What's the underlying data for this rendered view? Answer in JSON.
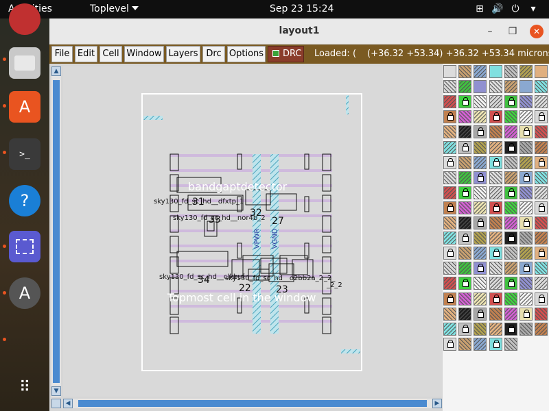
{
  "topbar": {
    "activities": "Activities",
    "app": "Toplevel",
    "clock": "Sep 23  15:24"
  },
  "window": {
    "title": "layout1"
  },
  "menu": [
    "File",
    "Edit",
    "Cell",
    "Window",
    "Layers",
    "Drc",
    "Options"
  ],
  "drc_label": "DRC",
  "status_text": "Loaded: (",
  "coords_text": "(+36.32 +53.34) +36.32 +53.34 microns",
  "canvas": {
    "overlay_title": "bandgaptdetector",
    "overlay_bottom": "Topmost cell in the window",
    "cell_labels": [
      "sky130_fd_sc_hd__dfxtp_1",
      "sky130_fd_sc_hd__nor4b_2",
      "sky130_fd_sc_hd__clkbuf",
      "sky130_fd_sc_hd__o2bb2a_2",
      "_2_",
      "_2_2"
    ],
    "numbers": [
      "31",
      "32",
      "33",
      "27",
      "34",
      "23",
      "22"
    ],
    "rail_labels": [
      "VPWR",
      "VGND"
    ]
  },
  "dock": {
    "items": [
      "firefox-icon",
      "files-icon",
      "software-icon",
      "terminal-icon",
      "help-icon",
      "screenshot-icon",
      "updater-icon",
      "apps-grid-icon"
    ]
  }
}
